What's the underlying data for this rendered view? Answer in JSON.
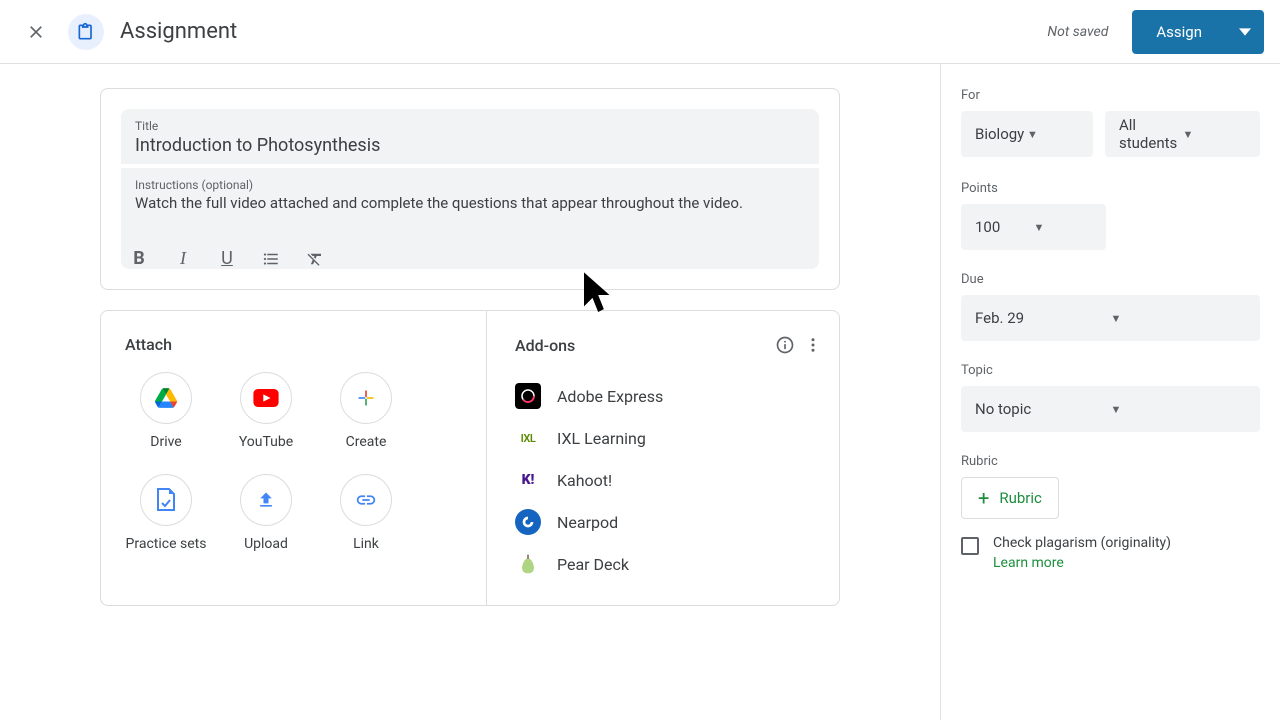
{
  "header": {
    "title": "Assignment",
    "status": "Not saved",
    "assign_label": "Assign"
  },
  "form": {
    "title_label": "Title",
    "title_value": "Introduction to Photosynthesis",
    "instructions_label": "Instructions (optional)",
    "instructions_value": "Watch the full video attached and complete the questions that appear throughout the video."
  },
  "attach": {
    "heading": "Attach",
    "items": [
      {
        "label": "Drive"
      },
      {
        "label": "YouTube"
      },
      {
        "label": "Create"
      },
      {
        "label": "Practice sets"
      },
      {
        "label": "Upload"
      },
      {
        "label": "Link"
      }
    ]
  },
  "addons": {
    "heading": "Add-ons",
    "items": [
      {
        "label": "Adobe Express"
      },
      {
        "label": "IXL Learning"
      },
      {
        "label": "Kahoot!"
      },
      {
        "label": "Nearpod"
      },
      {
        "label": "Pear Deck"
      }
    ]
  },
  "sidebar": {
    "for_label": "For",
    "class_value": "Biology",
    "students_value": "All students",
    "points_label": "Points",
    "points_value": "100",
    "due_label": "Due",
    "due_value": "Feb. 29",
    "topic_label": "Topic",
    "topic_value": "No topic",
    "rubric_label": "Rubric",
    "rubric_button": "Rubric",
    "plagiarism_label": "Check plagarism (originality)",
    "learn_more": "Learn more"
  }
}
